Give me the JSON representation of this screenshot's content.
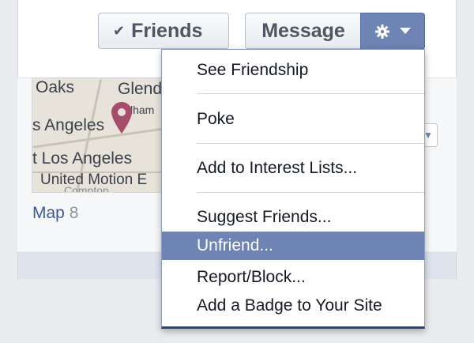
{
  "header": {
    "friends_label": "Friends",
    "message_label": "Message"
  },
  "map": {
    "labels": [
      "Oaks",
      "Glend",
      "lham",
      "s Angeles",
      "t Los Angeles",
      "United Motion E",
      "Compton"
    ],
    "link_label": "Map",
    "count": "8"
  },
  "menu": {
    "items": [
      "See Friendship",
      "Poke",
      "Add to Interest Lists...",
      "Suggest Friends...",
      "Unfriend...",
      "Report/Block...",
      "Add a Badge to Your Site"
    ],
    "highlighted": "Unfriend..."
  },
  "colors": {
    "accent": "#6d84b4",
    "link": "#3b5998",
    "pin": "#a64d6b"
  },
  "icons": [
    "check-icon",
    "gear-icon",
    "caret-down-icon",
    "map-pin-icon"
  ]
}
